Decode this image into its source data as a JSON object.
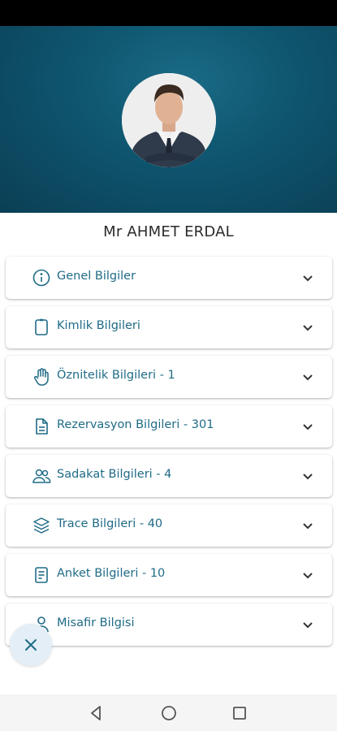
{
  "profile": {
    "name": "Mr AHMET ERDAL"
  },
  "sections": [
    {
      "label": "Genel Bilgiler",
      "icon": "info-icon"
    },
    {
      "label": "Kimlik Bilgileri",
      "icon": "id-card-icon"
    },
    {
      "label": "Öznitelik Bilgileri - 1",
      "icon": "hand-icon"
    },
    {
      "label": "Rezervasyon Bilgileri - 301",
      "icon": "document-icon"
    },
    {
      "label": "Sadakat Bilgileri - 4",
      "icon": "users-icon"
    },
    {
      "label": "Trace Bilgileri - 40",
      "icon": "layers-icon"
    },
    {
      "label": "Anket Bilgileri - 10",
      "icon": "survey-icon"
    },
    {
      "label": "Misafir Bilgisi",
      "icon": "user-icon"
    }
  ],
  "colors": {
    "accent": "#1f6b86",
    "header": "#0f5670"
  }
}
